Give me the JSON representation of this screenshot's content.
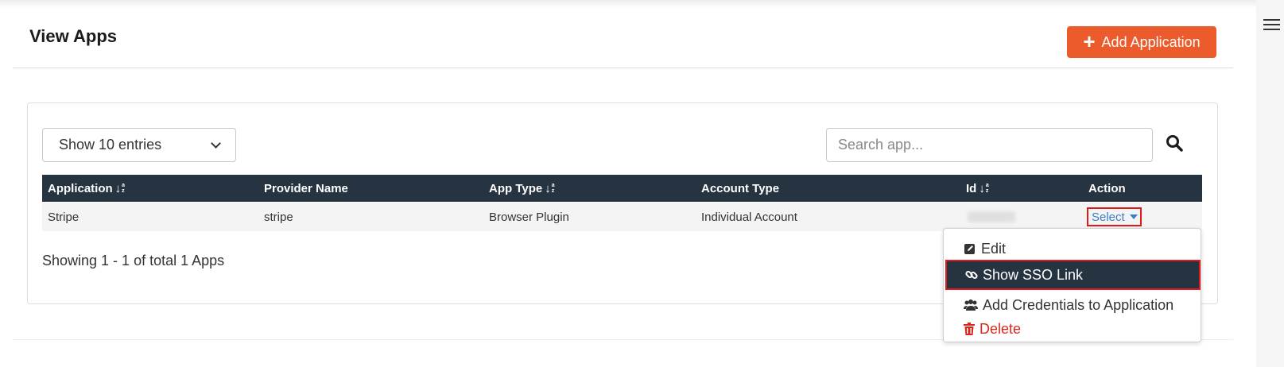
{
  "page": {
    "title": "View Apps"
  },
  "header": {
    "add_button_label": "Add Application"
  },
  "controls": {
    "entries_label": "Show 10 entries",
    "search_placeholder": "Search app..."
  },
  "table": {
    "columns": [
      "Application",
      "Provider Name",
      "App Type",
      "Account Type",
      "Id",
      "Action"
    ],
    "rows": [
      {
        "application": "Stripe",
        "provider": "stripe",
        "app_type": "Browser Plugin",
        "account_type": "Individual Account",
        "id": "",
        "action": "Select"
      }
    ],
    "summary": "Showing 1 - 1 of total 1 Apps"
  },
  "action_menu": {
    "items": [
      {
        "label": "Edit",
        "icon": "edit-icon"
      },
      {
        "label": "Show SSO Link",
        "icon": "link-icon",
        "highlighted": true
      },
      {
        "label": "Add Credentials to Application",
        "icon": "users-icon"
      },
      {
        "label": "Delete",
        "icon": "trash-icon"
      }
    ]
  },
  "colors": {
    "primary": "#ec5b2b",
    "table_header": "#263340",
    "link": "#3a7ec3",
    "danger": "#d9261c",
    "highlight_border": "#e01b1b"
  }
}
